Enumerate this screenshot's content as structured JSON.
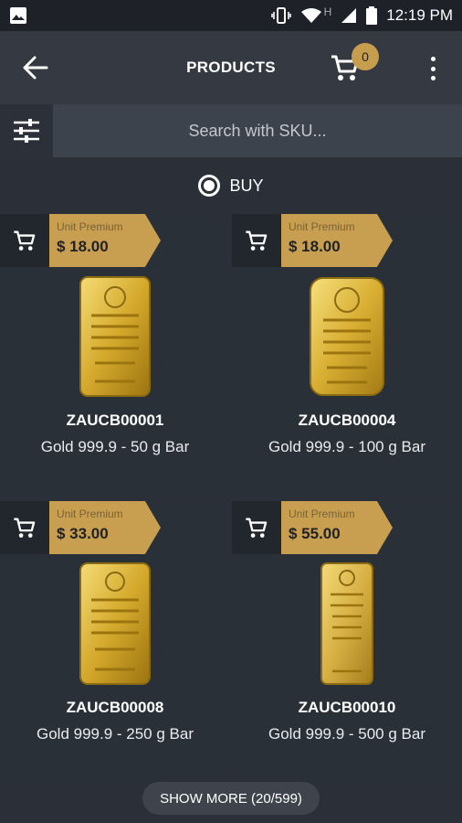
{
  "status_bar": {
    "time": "12:19 PM",
    "network": "H"
  },
  "header": {
    "title": "PRODUCTS",
    "cart_count": "0"
  },
  "search": {
    "placeholder": "Search with SKU..."
  },
  "mode": {
    "label": "BUY"
  },
  "products": [
    {
      "premium_label": "Unit Premium",
      "premium": "$ 18.00",
      "sku": "ZAUCB00001",
      "description": "Gold 999.9 - 50 g Bar"
    },
    {
      "premium_label": "Unit Premium",
      "premium": "$ 18.00",
      "sku": "ZAUCB00004",
      "description": "Gold 999.9 - 100 g Bar"
    },
    {
      "premium_label": "Unit Premium",
      "premium": "$ 33.00",
      "sku": "ZAUCB00008",
      "description": "Gold 999.9 - 250 g Bar"
    },
    {
      "premium_label": "Unit Premium",
      "premium": "$ 55.00",
      "sku": "ZAUCB00010",
      "description": "Gold 999.9 - 500 g Bar"
    }
  ],
  "footer": {
    "show_more": "SHOW MORE (20/599)"
  },
  "colors": {
    "gold": "#c89e50",
    "background": "#2b3038",
    "appbar": "#353a42"
  },
  "icons": [
    "image-icon",
    "vibrate-icon",
    "wifi-icon",
    "signal-icon",
    "battery-icon",
    "back-arrow-icon",
    "cart-icon",
    "more-vert-icon",
    "filter-icon",
    "radio-checked-icon",
    "gold-bar-icon"
  ]
}
